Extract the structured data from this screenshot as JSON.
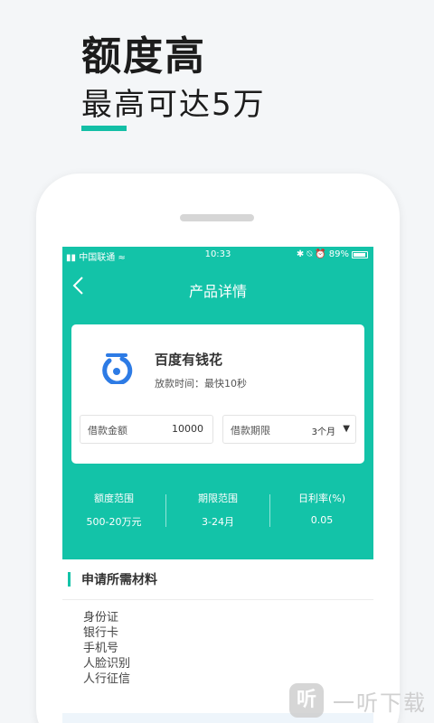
{
  "promo": {
    "headline": "额度高",
    "subline": "最高可达5万"
  },
  "status_bar": {
    "carrier": "中国联通",
    "time": "10:33",
    "battery": "89%"
  },
  "nav": {
    "title": "产品详情"
  },
  "product": {
    "name": "百度有钱花",
    "loan_time": "放款时间：最快10秒",
    "amount_label": "借款金额",
    "amount_value": "10000",
    "term_label": "借款期限",
    "term_value": "3个月"
  },
  "stats": [
    {
      "label": "额度范围",
      "value": "500-20万元"
    },
    {
      "label": "期限范围",
      "value": "3-24月"
    },
    {
      "label": "日利率(%)",
      "value": "0.05"
    }
  ],
  "materials": {
    "title": "申请所需材料",
    "items": [
      "身份证",
      "银行卡",
      "手机号",
      "人脸识别",
      "人行征信"
    ]
  },
  "watermark": {
    "text": "一听下载"
  },
  "colors": {
    "accent": "#13c3a8",
    "logo_blue": "#2d7be5"
  }
}
